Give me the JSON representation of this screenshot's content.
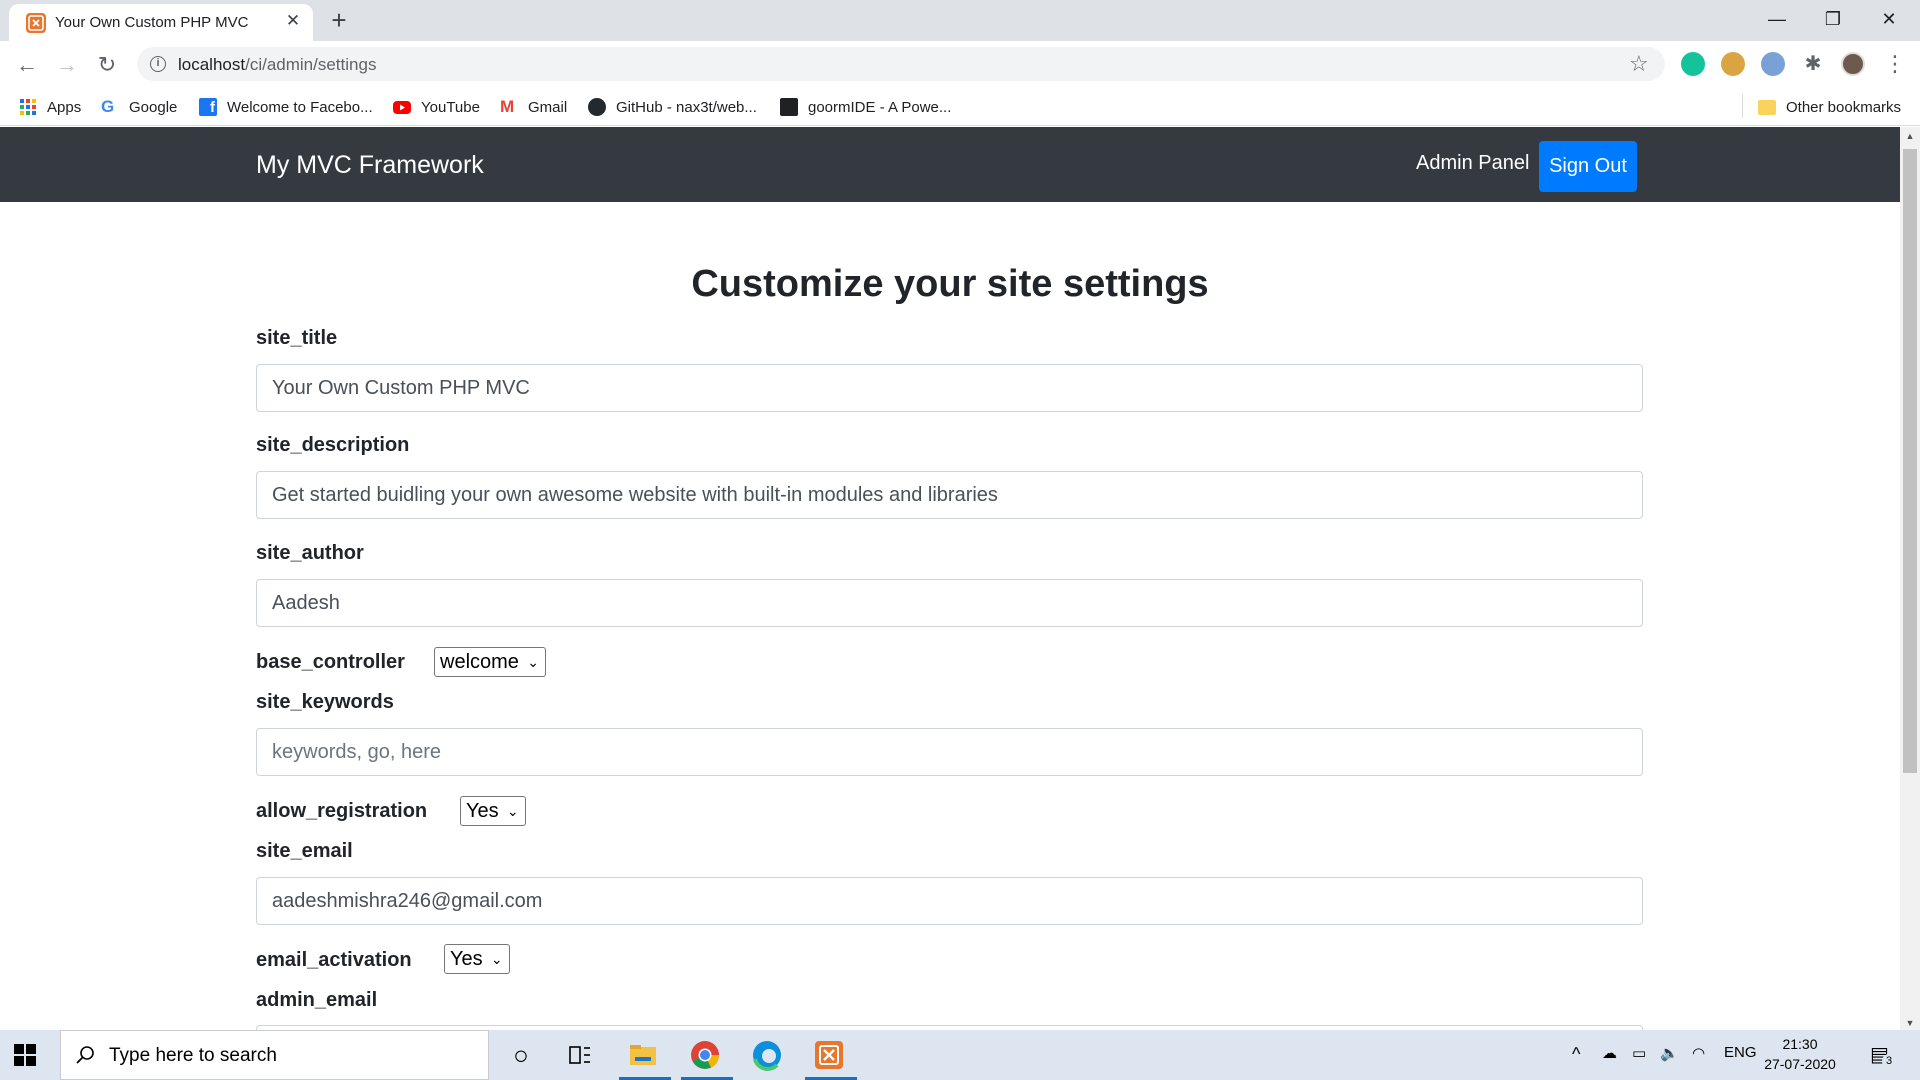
{
  "browser": {
    "tab_title": "Your Own Custom PHP MVC",
    "url_host": "localhost",
    "url_path": "/ci/admin/settings",
    "bookmarks": [
      {
        "label": "Apps",
        "icon": "apps-grid-icon"
      },
      {
        "label": "Google",
        "icon": "google-icon"
      },
      {
        "label": "Welcome to Facebo...",
        "icon": "facebook-icon"
      },
      {
        "label": "YouTube",
        "icon": "youtube-icon"
      },
      {
        "label": "Gmail",
        "icon": "gmail-icon"
      },
      {
        "label": "GitHub - nax3t/web...",
        "icon": "github-icon"
      },
      {
        "label": "goormIDE - A Powe...",
        "icon": "goorm-icon"
      }
    ],
    "other_bookmarks": "Other bookmarks"
  },
  "navbar": {
    "brand": "My MVC Framework",
    "admin_link": "Admin Panel",
    "signout": "Sign Out"
  },
  "page": {
    "heading": "Customize your site settings",
    "fields": {
      "site_title": {
        "label": "site_title",
        "value": "Your Own Custom PHP MVC"
      },
      "site_description": {
        "label": "site_description",
        "value": "Get started buidling your own awesome website with built-in modules and libraries"
      },
      "site_author": {
        "label": "site_author",
        "value": "Aadesh"
      },
      "base_controller": {
        "label": "base_controller",
        "value": "welcome"
      },
      "site_keywords": {
        "label": "site_keywords",
        "placeholder": "keywords, go, here"
      },
      "allow_registration": {
        "label": "allow_registration",
        "value": "Yes"
      },
      "site_email": {
        "label": "site_email",
        "value": "aadeshmishra246@gmail.com"
      },
      "email_activation": {
        "label": "email_activation",
        "value": "Yes"
      },
      "admin_email": {
        "label": "admin_email"
      }
    }
  },
  "taskbar": {
    "search_placeholder": "Type here to search",
    "lang": "ENG",
    "time": "21:30",
    "date": "27-07-2020",
    "notifications": "3"
  },
  "colors": {
    "navbar_bg": "#343a40",
    "primary": "#007bff",
    "xampp_orange": "#e8762d"
  }
}
